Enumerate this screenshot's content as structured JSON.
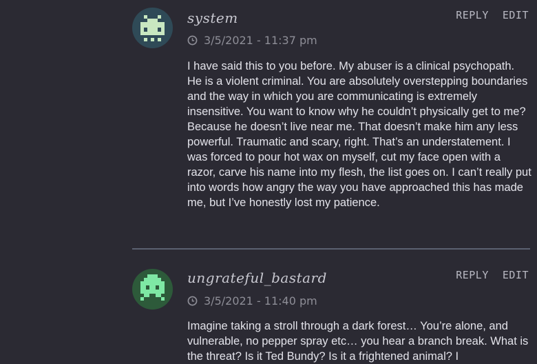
{
  "comments": [
    {
      "author": "system",
      "timestamp": "3/5/2021 - 11:37 pm",
      "reply_label": "REPLY",
      "edit_label": "EDIT",
      "text": "I have said this to you before. My abuser is a clinical psychopath. He is a violent criminal. You are absolutely overstepping boundaries and the way in which you are communicating is extremely insensitive. You want to know why he couldn’t physically get to me? Because he doesn’t live near me. That doesn’t make him any less powerful. Traumatic and scary, right. That’s an understatement. I was forced to pour hot wax on myself, cut my face open with a razor, carve his name into my flesh, the list goes on. I can’t really put into words how angry the way you have approached this has made me, but I’ve honestly lost my patience.",
      "avatar_bg": "#2f4a57",
      "avatar_fg": "#c8e7c0"
    },
    {
      "author": "ungrateful_bastard",
      "timestamp": "3/5/2021 - 11:40 pm",
      "reply_label": "REPLY",
      "edit_label": "EDIT",
      "text": "Imagine taking a stroll through a dark forest… You’re alone, and vulnerable, no pepper spray etc… you hear a branch break. What is the threat? Is it Ted Bundy? Is it a frightened animal? I",
      "avatar_bg": "#2d5a3a",
      "avatar_fg": "#7ee8a4"
    }
  ]
}
